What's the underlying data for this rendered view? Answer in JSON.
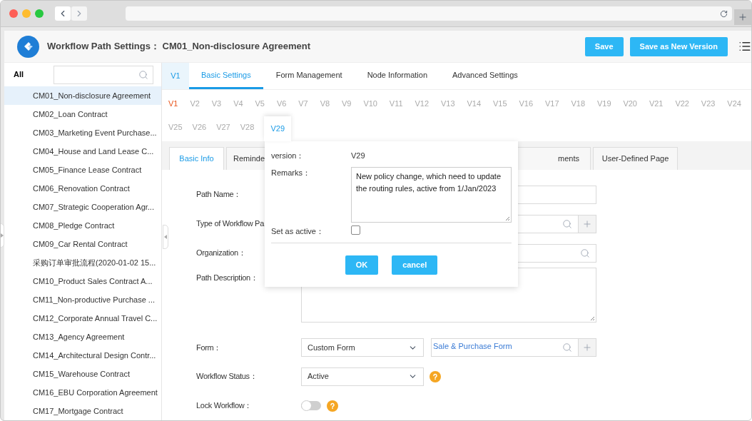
{
  "header": {
    "title": "Workflow Path Settings： CM01_Non-disclosure Agreement",
    "buttons": [
      "Save",
      "Save as New Version"
    ]
  },
  "sidebar": {
    "filter_label": "All",
    "items": [
      {
        "label": "CM01_Non-disclosure Agreement",
        "selected": true
      },
      {
        "label": "CM02_Loan Contract",
        "selected": false
      },
      {
        "label": "CM03_Marketing Event Purchase...",
        "selected": false
      },
      {
        "label": "CM04_House and Land Lease C...",
        "selected": false
      },
      {
        "label": "CM05_Finance Lease Contract",
        "selected": false
      },
      {
        "label": "CM06_Renovation Contract",
        "selected": false
      },
      {
        "label": "CM07_Strategic Cooperation Agr...",
        "selected": false
      },
      {
        "label": "CM08_Pledge Contract",
        "selected": false
      },
      {
        "label": "CM09_Car Rental Contract",
        "selected": false
      },
      {
        "label": "采购订单审批流程(2020-01-02 15...",
        "selected": false
      },
      {
        "label": "CM10_Product Sales Contract A...",
        "selected": false
      },
      {
        "label": "CM11_Non-productive Purchase ...",
        "selected": false
      },
      {
        "label": "CM12_Corporate Annual Travel C...",
        "selected": false
      },
      {
        "label": "CM13_Agency Agreement",
        "selected": false
      },
      {
        "label": "CM14_Architectural Design Contr...",
        "selected": false
      },
      {
        "label": "CM15_Warehouse Contract",
        "selected": false
      },
      {
        "label": "CM16_EBU Corporation Agreement",
        "selected": false
      },
      {
        "label": "CM17_Mortgage Contract",
        "selected": false
      }
    ]
  },
  "main_tabs": [
    {
      "label": "V1",
      "kind": "version",
      "selected": false
    },
    {
      "label": "Basic Settings",
      "kind": "tab",
      "selected": true
    },
    {
      "label": "Form Management",
      "kind": "tab",
      "selected": false
    },
    {
      "label": "Node Information",
      "kind": "tab",
      "selected": false
    },
    {
      "label": "Advanced Settings",
      "kind": "tab",
      "selected": false
    }
  ],
  "versions": [
    {
      "label": "V1",
      "current": true,
      "selected": false
    },
    {
      "label": "V2",
      "current": false,
      "selected": false
    },
    {
      "label": "V3",
      "current": false,
      "selected": false
    },
    {
      "label": "V4",
      "current": false,
      "selected": false
    },
    {
      "label": "V5",
      "current": false,
      "selected": false
    },
    {
      "label": "V6",
      "current": false,
      "selected": false
    },
    {
      "label": "V7",
      "current": false,
      "selected": false
    },
    {
      "label": "V8",
      "current": false,
      "selected": false
    },
    {
      "label": "V9",
      "current": false,
      "selected": false
    },
    {
      "label": "V10",
      "current": false,
      "selected": false
    },
    {
      "label": "V11",
      "current": false,
      "selected": false
    },
    {
      "label": "V12",
      "current": false,
      "selected": false
    },
    {
      "label": "V13",
      "current": false,
      "selected": false
    },
    {
      "label": "V14",
      "current": false,
      "selected": false
    },
    {
      "label": "V15",
      "current": false,
      "selected": false
    },
    {
      "label": "V16",
      "current": false,
      "selected": false
    },
    {
      "label": "V17",
      "current": false,
      "selected": false
    },
    {
      "label": "V18",
      "current": false,
      "selected": false
    },
    {
      "label": "V19",
      "current": false,
      "selected": false
    },
    {
      "label": "V20",
      "current": false,
      "selected": false
    },
    {
      "label": "V21",
      "current": false,
      "selected": false
    },
    {
      "label": "V22",
      "current": false,
      "selected": false
    },
    {
      "label": "V23",
      "current": false,
      "selected": false
    },
    {
      "label": "V24",
      "current": false,
      "selected": false
    },
    {
      "label": "V25",
      "current": false,
      "selected": false
    },
    {
      "label": "V26",
      "current": false,
      "selected": false
    },
    {
      "label": "V27",
      "current": false,
      "selected": false
    },
    {
      "label": "V28",
      "current": false,
      "selected": false
    },
    {
      "label": "V29",
      "current": false,
      "selected": true
    }
  ],
  "sub_tabs": [
    {
      "label": "Basic Info",
      "selected": true
    },
    {
      "label": "Reminde",
      "selected": false
    },
    {
      "label": "ments",
      "selected": false
    },
    {
      "label": "User-Defined Page",
      "selected": false
    }
  ],
  "form": [
    {
      "label": "Path Name：",
      "kind": "text"
    },
    {
      "label": "Type of Workflow Pa",
      "kind": "lookup"
    },
    {
      "label": "Organization：",
      "kind": "search"
    },
    {
      "label": "Path Description：",
      "kind": "textarea"
    },
    {
      "label": "Form：",
      "kind": "form",
      "value": "Custom Form",
      "lookup_value": "Sale & Purchase Form"
    },
    {
      "label": "Workflow Status：",
      "kind": "select",
      "value": "Active",
      "help": true
    },
    {
      "label": "Lock Workflow：",
      "kind": "toggle",
      "on": false,
      "help": true
    }
  ],
  "version_popup": {
    "fields": [
      {
        "label": "version：",
        "kind": "text",
        "value": "V29"
      },
      {
        "label": "Remarks：",
        "kind": "textarea",
        "value": "New policy change, which need to update the routing rules, active from 1/Jan/2023"
      },
      {
        "label": "Set as active：",
        "kind": "checkbox",
        "checked": false
      }
    ],
    "buttons": [
      "OK",
      "cancel"
    ]
  }
}
